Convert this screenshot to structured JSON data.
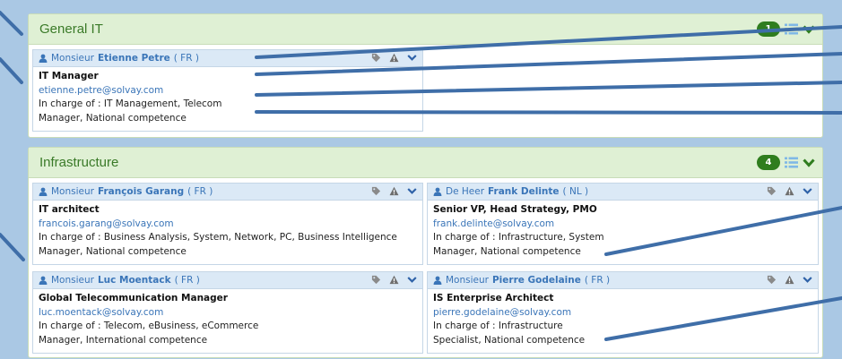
{
  "sections": [
    {
      "title": "General IT",
      "count": "1",
      "contacts": [
        {
          "salutation": "Monsieur",
          "name": "Etienne Petre",
          "country": "( FR )",
          "role": "IT Manager",
          "email": "etienne.petre@solvay.com",
          "charge_line1": "In charge of : IT Management, Telecom",
          "charge_line2": "Manager, National competence"
        }
      ]
    },
    {
      "title": "Infrastructure",
      "count": "4",
      "contacts": [
        {
          "salutation": "Monsieur",
          "name": "François Garang",
          "country": "( FR )",
          "role": "IT architect",
          "email": "francois.garang@solvay.com",
          "charge_line1": "In charge of : Business Analysis, System, Network, PC, Business Intelligence",
          "charge_line2": "Manager, National competence"
        },
        {
          "salutation": "De Heer",
          "name": "Frank Delinte",
          "country": "( NL )",
          "role": "Senior VP, Head Strategy, PMO",
          "email": "frank.delinte@solvay.com",
          "charge_line1": "In charge of : Infrastructure, System",
          "charge_line2": "Manager, National competence"
        },
        {
          "salutation": "Monsieur",
          "name": "Luc Moentack",
          "country": "( FR )",
          "role": "Global Telecommunication Manager",
          "email": "luc.moentack@solvay.com",
          "charge_line1": "In charge of : Telecom, eBusiness, eCommerce",
          "charge_line2": "Manager, International competence"
        },
        {
          "salutation": "Monsieur",
          "name": "Pierre Godelaine",
          "country": "( FR )",
          "role": "IS Enterprise Architect",
          "email": "pierre.godelaine@solvay.com",
          "charge_line1": "In charge of : Infrastructure",
          "charge_line2": "Specialist, National competence"
        }
      ]
    }
  ],
  "icons": {
    "person": "person-icon",
    "tag": "tag-icon",
    "warning": "warning-icon",
    "expand": "chevron-down-icon",
    "list": "list-icon"
  },
  "colors": {
    "section_header_bg": "#dff0d4",
    "section_title": "#3a7a28",
    "badge": "#2f7d1e",
    "card_header_bg": "#dbe9f6",
    "link_blue": "#3a75b8",
    "annotation_line": "#3f6ea8",
    "background": "#aac8e4"
  }
}
